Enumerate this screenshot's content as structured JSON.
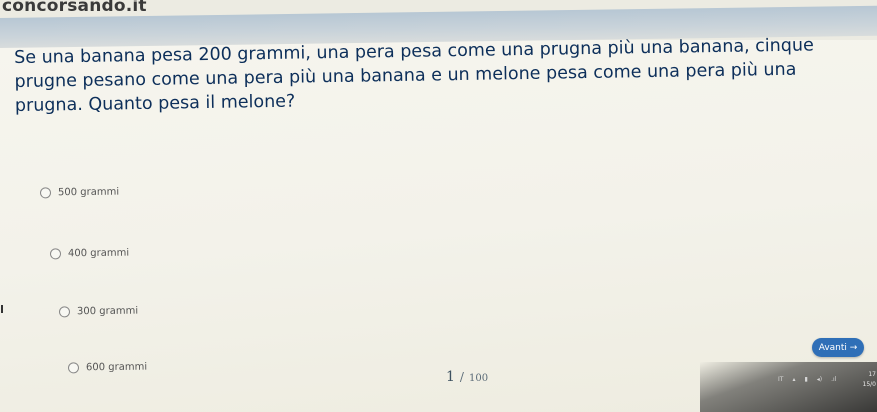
{
  "site": {
    "name": "concorsando.it"
  },
  "quiz": {
    "question": "Se una banana pesa 200 grammi, una pera pesa come una prugna più una banana, cinque prugne pesano come una pera più una banana e un melone pesa come una pera più una prugna. Quanto pesa il melone?",
    "options": [
      {
        "label": "500 grammi"
      },
      {
        "label": "400 grammi"
      },
      {
        "label": "300 grammi"
      },
      {
        "label": "600 grammi"
      }
    ],
    "next_label": "Avanti →",
    "current": "1",
    "separator": "/",
    "total": "100"
  },
  "system_tray": {
    "lang": "IT",
    "time": "17",
    "date": "15/0"
  }
}
